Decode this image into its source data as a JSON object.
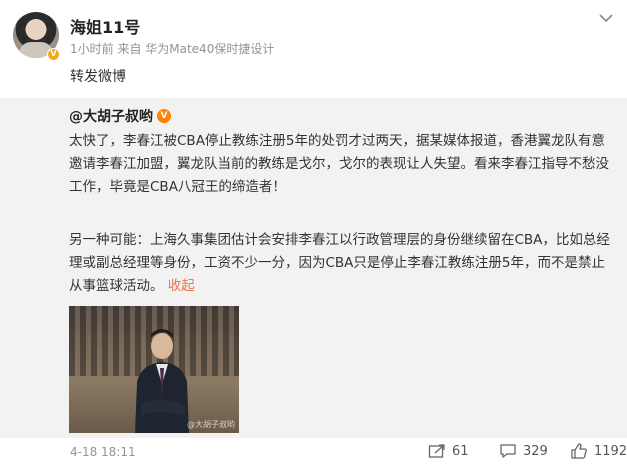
{
  "header": {
    "username": "海姐11号",
    "meta": "1小时前  来自 华为Mate40保时捷设计",
    "repost_text": "转发微博"
  },
  "repost": {
    "author": "@大胡子叔哟",
    "paragraph1": "太快了，李春江被CBA停止教练注册5年的处罚才过两天，据某媒体报道，香港翼龙队有意邀请李春江加盟，翼龙队当前的教练是戈尔，戈尔的表现让人失望。看来李春江指导不愁没工作，毕竟是CBA八冠王的缔造者！",
    "paragraph2": "另一种可能：上海久事集团估计会安排李春江以行政管理层的身份继续留在CBA，比如总经理或副总经理等身份，工资不少一分，因为CBA只是停止李春江教练注册5年，而不是禁止从事篮球活动。",
    "collapse_label": "收起",
    "watermark": "@大胡子叔哟"
  },
  "footer": {
    "date": "4-18 18:11",
    "share_count": "61",
    "comment_count": "329",
    "like_count": "1192"
  },
  "colors": {
    "accent_link": "#eb7350",
    "repost_bg": "#f2f2f2",
    "meta_gray": "#939393",
    "verified_orange": "#ff8200"
  },
  "icons": {
    "more": "chevron-down-icon",
    "share": "share-icon",
    "comment": "comment-icon",
    "like": "like-icon",
    "verified": "verified-icon"
  }
}
